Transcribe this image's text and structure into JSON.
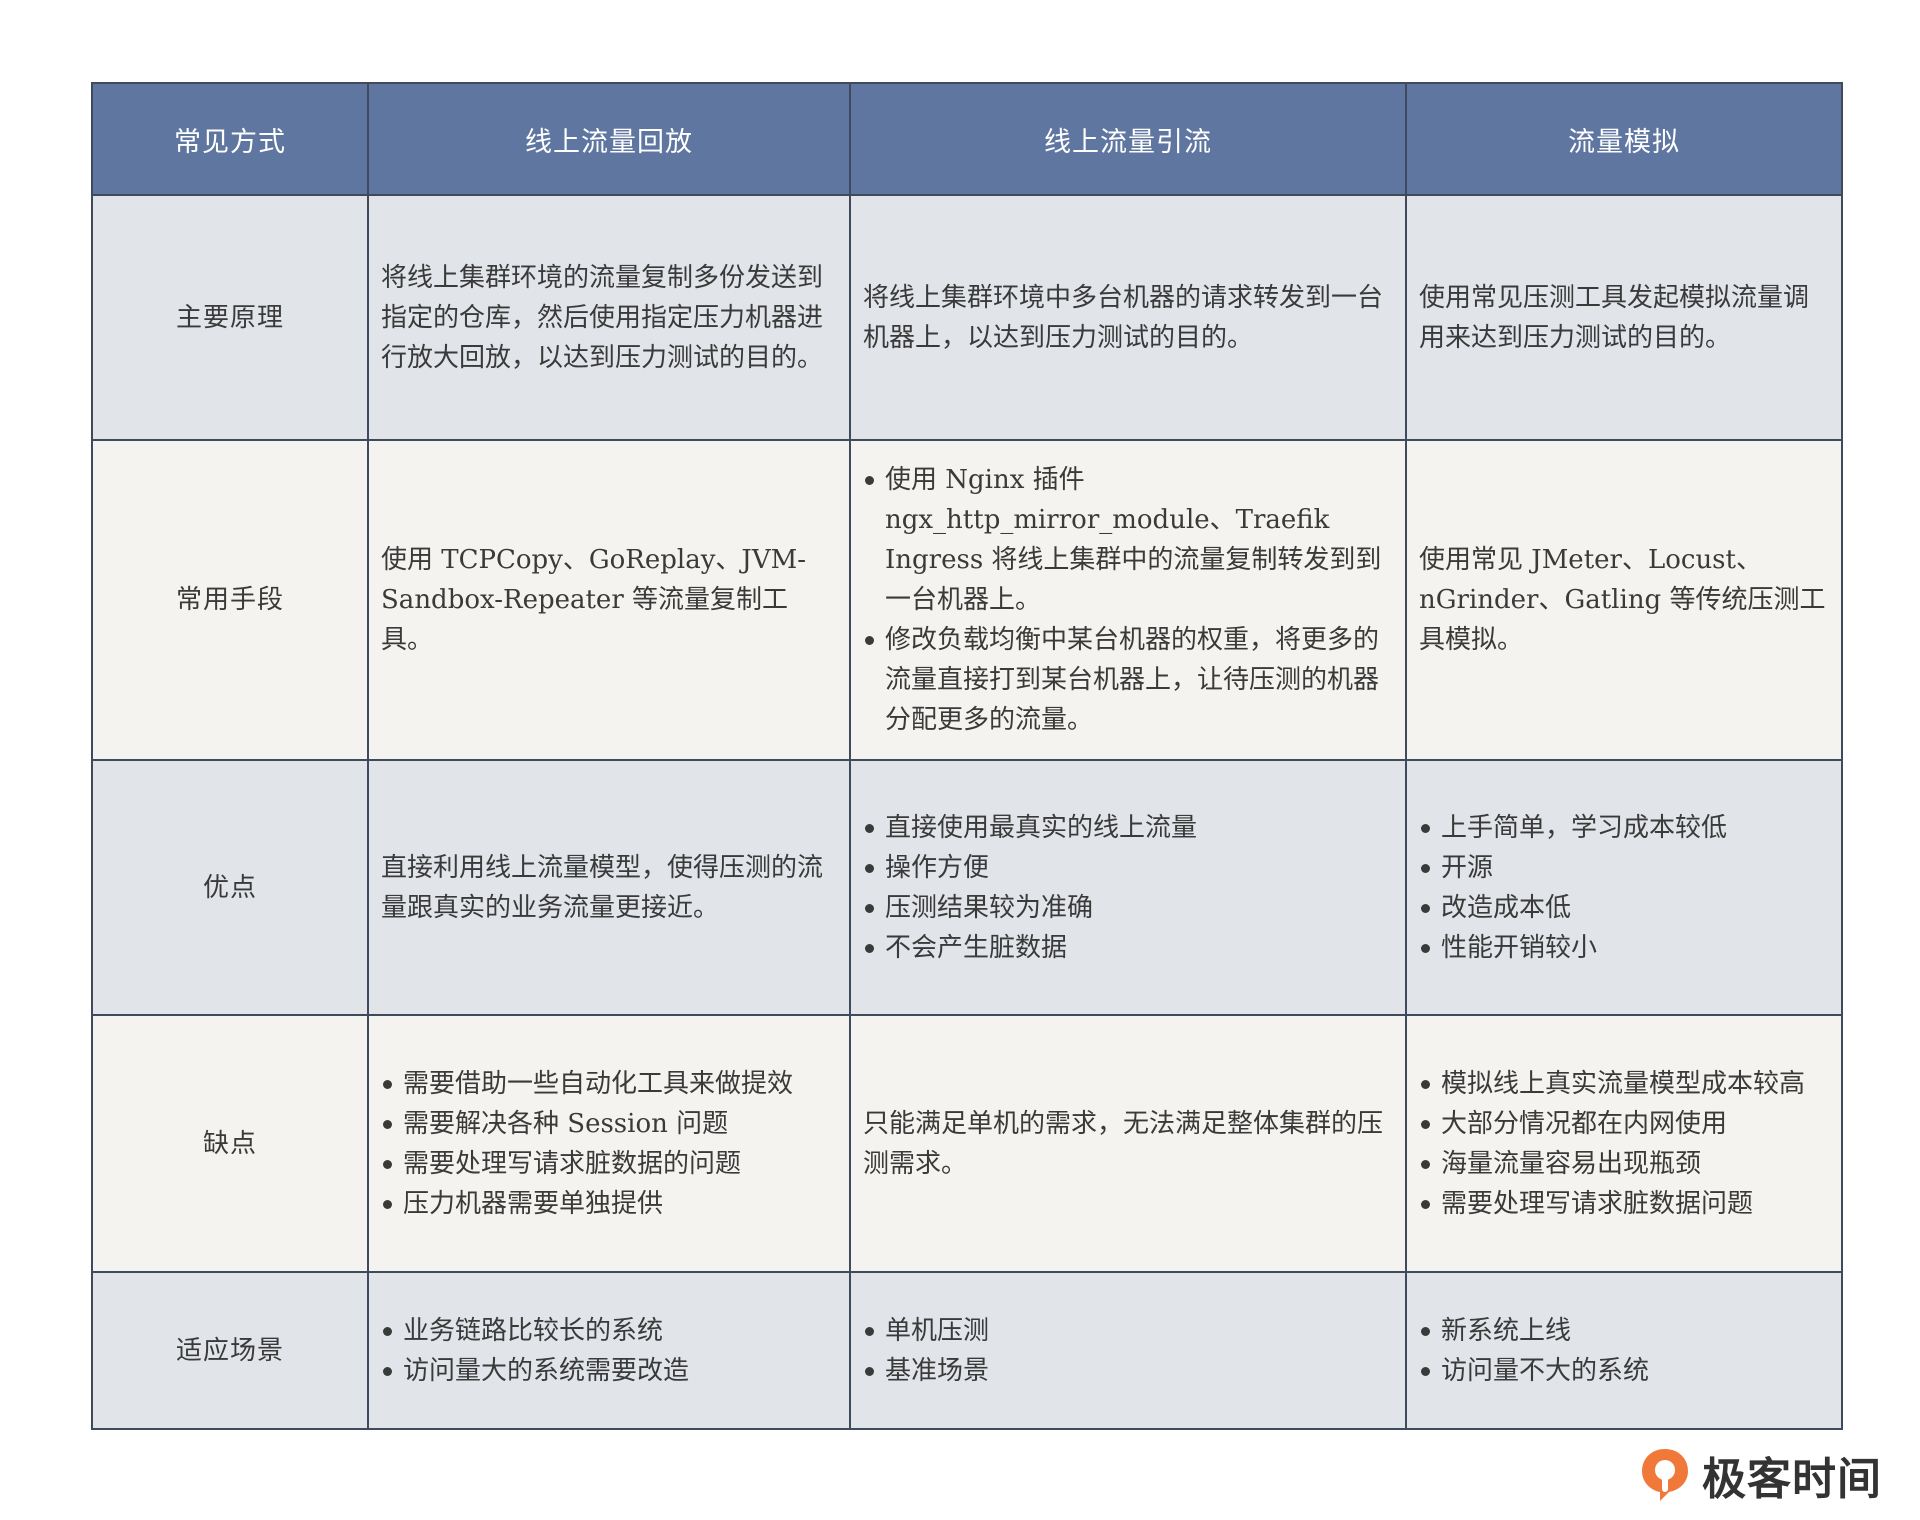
{
  "header": {
    "col0": "常见方式",
    "col1": "线上流量回放",
    "col2": "线上流量引流",
    "col3": "流量模拟"
  },
  "rows": {
    "principle": {
      "label": "主要原理",
      "replay": "将线上集群环境的流量复制多份发送到指定的仓库，然后使用指定压力机器进行放大回放，以达到压力测试的目的。",
      "diversion": "将线上集群环境中多台机器的请求转发到一台机器上，以达到压力测试的目的。",
      "simulation": "使用常见压测工具发起模拟流量调用来达到压力测试的目的。"
    },
    "means": {
      "label": "常用手段",
      "replay": "使用 TCPCopy、GoReplay、JVM-Sandbox-Repeater 等流量复制工具。",
      "diversion": [
        "使用 Nginx 插件 ngx_http_mirror_module、Traefik Ingress 将线上集群中的流量复制转发到到一台机器上。",
        "修改负载均衡中某台机器的权重，将更多的流量直接打到某台机器上，让待压测的机器分配更多的流量。"
      ],
      "simulation": "使用常见 JMeter、Locust、nGrinder、Gatling 等传统压测工具模拟。"
    },
    "pros": {
      "label": "优点",
      "replay": "直接利用线上流量模型，使得压测的流量跟真实的业务流量更接近。",
      "diversion": [
        "直接使用最真实的线上流量",
        "操作方便",
        "压测结果较为准确",
        "不会产生脏数据"
      ],
      "simulation": [
        "上手简单，学习成本较低",
        "开源",
        "改造成本低",
        "性能开销较小"
      ]
    },
    "cons": {
      "label": "缺点",
      "replay": [
        "需要借助一些自动化工具来做提效",
        "需要解决各种 Session 问题",
        "需要处理写请求脏数据的问题",
        "压力机器需要单独提供"
      ],
      "diversion": "只能满足单机的需求，无法满足整体集群的压测需求。",
      "simulation": [
        "模拟线上真实流量模型成本较高",
        "大部分情况都在内网使用",
        "海量流量容易出现瓶颈",
        "需要处理写请求脏数据问题"
      ]
    },
    "scenarios": {
      "label": "适应场景",
      "replay": [
        "业务链路比较长的系统",
        "访问量大的系统需要改造"
      ],
      "diversion": [
        "单机压测",
        "基准场景"
      ],
      "simulation": [
        "新系统上线",
        "访问量不大的系统"
      ]
    }
  },
  "logo": {
    "text": "极客时间",
    "icon": "geektime-logo-icon",
    "color": "#f0793a"
  }
}
